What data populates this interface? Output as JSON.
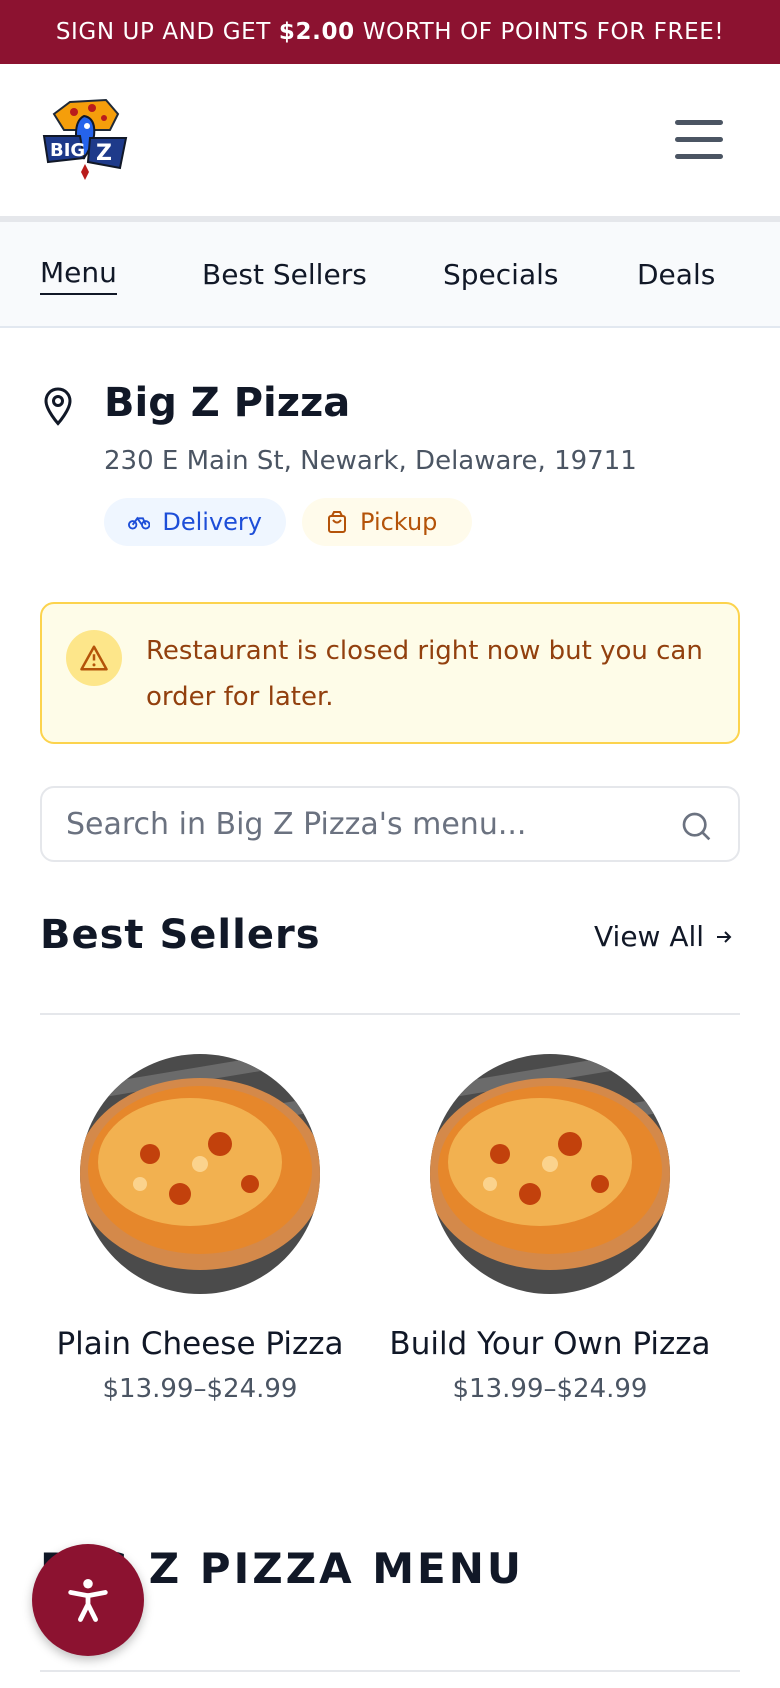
{
  "promo": {
    "prefix": "SIGN UP AND GET",
    "amount": "$2.00",
    "suffix": "WORTH OF POINTS FOR FREE!"
  },
  "header": {
    "logo_text": "BIG Z"
  },
  "tabs": [
    {
      "label": "Menu",
      "active": true
    },
    {
      "label": "Best Sellers"
    },
    {
      "label": "Specials"
    },
    {
      "label": "Deals"
    }
  ],
  "store": {
    "name": "Big Z Pizza",
    "address": "230 E Main St, Newark, Delaware, 19711",
    "delivery_label": "Delivery",
    "pickup_label": "Pickup"
  },
  "alert": {
    "text": "Restaurant is closed right now but you can order for later."
  },
  "search": {
    "placeholder": "Search in Big Z Pizza's menu..."
  },
  "best_sellers": {
    "title": "Best Sellers",
    "view_all": "View All",
    "items": [
      {
        "name": "Plain Cheese Pizza",
        "price": "$13.99–$24.99"
      },
      {
        "name": "Build Your Own Pizza",
        "price": "$13.99–$24.99"
      }
    ]
  },
  "menu_section": {
    "title": "BIG Z PIZZA MENU"
  },
  "colors": {
    "brand": "#8c1230",
    "alert_text": "#92400e",
    "delivery": "#1d4ed8",
    "pickup": "#b45309"
  },
  "icons": [
    "hamburger-menu-icon",
    "map-pin-icon",
    "bicycle-icon",
    "shopping-bag-icon",
    "warning-icon",
    "search-icon",
    "arrow-right-icon",
    "accessibility-icon"
  ]
}
